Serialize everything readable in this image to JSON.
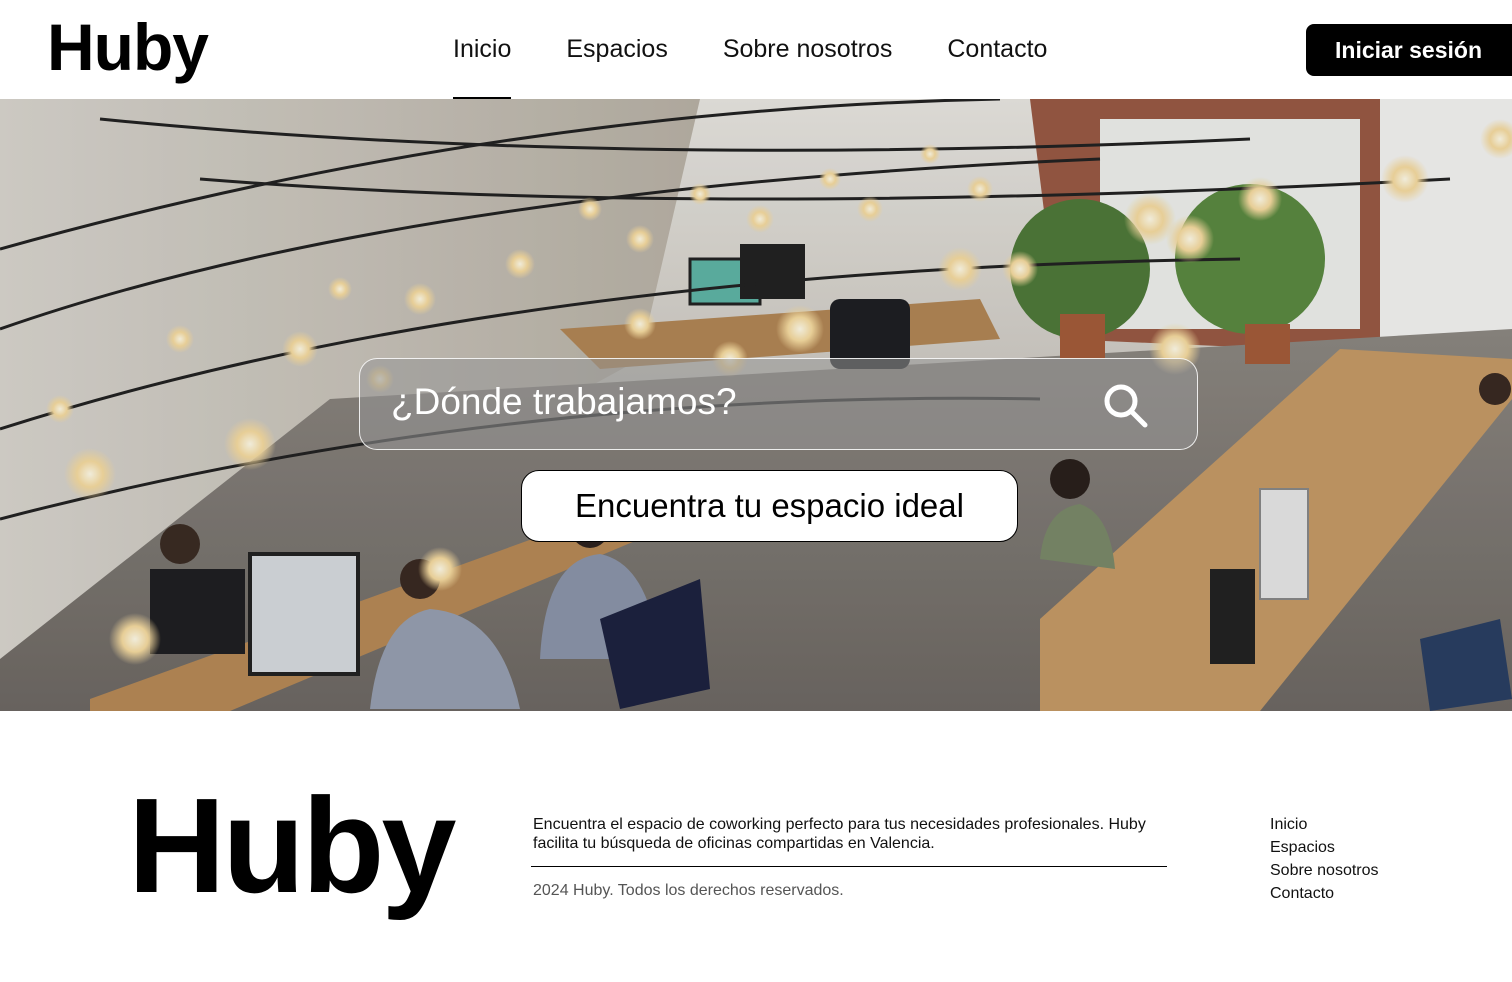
{
  "header": {
    "logo": "Huby",
    "nav": [
      {
        "label": "Inicio",
        "active": true
      },
      {
        "label": "Espacios"
      },
      {
        "label": "Sobre nosotros"
      },
      {
        "label": "Contacto"
      }
    ],
    "login_label": "Iniciar sesión"
  },
  "hero": {
    "search_placeholder": "¿Dónde trabajamos?",
    "search_icon": "search-icon",
    "cta_label": "Encuentra tu espacio ideal"
  },
  "footer": {
    "logo": "Huby",
    "description": "Encuentra el espacio de coworking perfecto para tus necesidades profesionales. Huby facilita tu búsqueda de oficinas compartidas en Valencia.",
    "copyright": "2024 Huby. Todos los derechos reservados.",
    "links": [
      "Inicio",
      "Espacios",
      "Sobre nosotros",
      "Contacto"
    ]
  }
}
